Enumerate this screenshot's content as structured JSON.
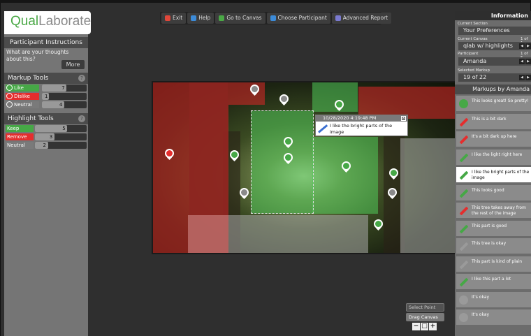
{
  "app": {
    "logo_qual": "Qual",
    "logo_laborate": "Laborate"
  },
  "left_panel": {
    "instructions_title": "Participant Instructions",
    "instructions_text": "What are your thoughts about this?",
    "more_label": "More",
    "markup_tools_title": "Markup Tools",
    "markup_tools": [
      {
        "label": "Like",
        "count": "7",
        "color": "#46a846",
        "fill_fraction": 0.55
      },
      {
        "label": "Dislike",
        "count": "1",
        "color": "#e52d2d",
        "fill_fraction": 0.0
      },
      {
        "label": "Neutral",
        "count": "4",
        "color": "#7a7a7a",
        "fill_fraction": 0.5
      }
    ],
    "highlight_tools_title": "Highlight Tools",
    "highlight_tools": [
      {
        "label": "Keep",
        "count": "5",
        "color": "#46a846"
      },
      {
        "label": "Remove",
        "count": "3",
        "color": "#e52d2d"
      },
      {
        "label": "Neutral",
        "count": "2",
        "color": "#7a7a7a"
      }
    ],
    "help_glyph": "?"
  },
  "toolbar": {
    "buttons": [
      {
        "label": "Exit",
        "icon": "exit-icon",
        "color": "#e0473a"
      },
      {
        "label": "Help",
        "icon": "help-icon",
        "color": "#3c8bd8"
      },
      {
        "label": "Go to Canvas",
        "icon": "canvas-icon",
        "color": "#4aa846"
      },
      {
        "label": "Choose Participant",
        "icon": "participant-icon",
        "color": "#3c8bd8"
      },
      {
        "label": "Advanced Report",
        "icon": "report-icon",
        "color": "#7a7ad0"
      }
    ]
  },
  "popup": {
    "timestamp": "10/28/2020 4:19:48 PM",
    "text": "I like the bright parts of the image",
    "close": "x"
  },
  "right_panel": {
    "title": "Information",
    "current_section_label": "Current Section",
    "current_section": "Your Preferences",
    "current_canvas_label": "Current Canvas",
    "current_canvas_count": "1 of 1",
    "current_canvas": "qlab w/ highlights",
    "participant_label": "Participant",
    "participant_count": "1 of 5",
    "participant": "Amanda",
    "selected_markup_label": "Selected Markup",
    "selected_markup": "19 of 22",
    "markups_title": "Markups by Amanda",
    "markups": [
      {
        "text": "This looks great! So pretty!",
        "kind": "face",
        "color": "#46a846",
        "selected": false
      },
      {
        "text": "This is a bit dark",
        "kind": "pen",
        "color": "#e52d2d",
        "selected": false
      },
      {
        "text": "It's a bit dark up here",
        "kind": "pen",
        "color": "#e52d2d",
        "selected": false
      },
      {
        "text": "I like the light right here",
        "kind": "pen",
        "color": "#46a846",
        "selected": false
      },
      {
        "text": "I like the bright parts of the image",
        "kind": "pen",
        "color": "#46a846",
        "selected": true
      },
      {
        "text": "This looks good",
        "kind": "pen",
        "color": "#46a846",
        "selected": false
      },
      {
        "text": "This tree takes away from the rest of the image",
        "kind": "pen",
        "color": "#e52d2d",
        "selected": false
      },
      {
        "text": "This part is good",
        "kind": "pen",
        "color": "#46a846",
        "selected": false
      },
      {
        "text": "This tree is okay",
        "kind": "pen",
        "color": "#9a9a9a",
        "selected": false
      },
      {
        "text": "This part is kind of plain",
        "kind": "pen",
        "color": "#9a9a9a",
        "selected": false
      },
      {
        "text": "I like this part a lot",
        "kind": "pen",
        "color": "#46a846",
        "selected": false
      },
      {
        "text": "It's okay",
        "kind": "face",
        "color": "#9a9a9a",
        "selected": false
      },
      {
        "text": "It's okay",
        "kind": "face",
        "color": "#9a9a9a",
        "selected": false
      }
    ]
  },
  "canvas_tools": {
    "select_point": "Select Point",
    "drag_canvas": "Drag Canvas",
    "zoom_out": "−",
    "zoom_reset": "□",
    "zoom_in": "+"
  }
}
